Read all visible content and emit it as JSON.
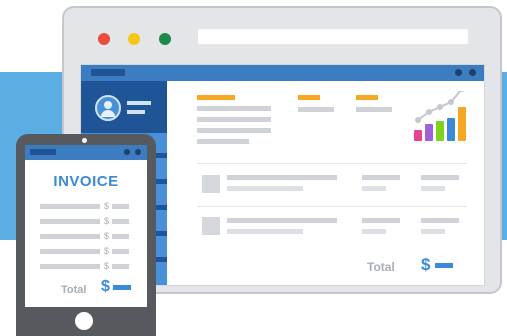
{
  "colors": {
    "band": "#5aaee1",
    "brand_blue": "#3b7dc0",
    "dark_blue": "#1f5596",
    "accent_orange": "#f5a623",
    "total_blue": "#3b8ad9"
  },
  "browser": {
    "traffic_lights": [
      "#e74c3c",
      "#f5c518",
      "#1e8a4a"
    ]
  },
  "dashboard": {
    "total_label": "Total",
    "currency_symbol": "$",
    "chart": {
      "type": "bar",
      "icon": "bar-chart-with-trend-line-icon",
      "bar_colors": [
        "#e84393",
        "#a05fd6",
        "#7ed321",
        "#3b8ad9",
        "#f5a623"
      ],
      "relative_values": [
        0.33,
        0.5,
        0.58,
        0.67,
        1.0
      ]
    }
  },
  "invoice": {
    "title": "INVOICE",
    "row_currency": "$",
    "row_count": 5,
    "total_label": "Total",
    "currency_symbol": "$"
  }
}
